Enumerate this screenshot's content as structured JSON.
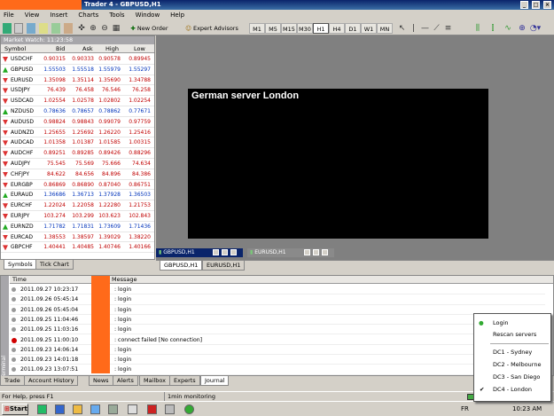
{
  "window": {
    "title": "Trader 4 - GBPUSD,H1"
  },
  "menu": [
    "File",
    "View",
    "Insert",
    "Charts",
    "Tools",
    "Window",
    "Help"
  ],
  "toolbar": {
    "new_order": "New Order",
    "expert_advisors": "Expert Advisors",
    "timeframes": [
      "M1",
      "M5",
      "M15",
      "M30",
      "H1",
      "H4",
      "D1",
      "W1",
      "MN"
    ],
    "selected_timeframe": "H1"
  },
  "market_watch": {
    "title": "Market Watch: 11:23:58",
    "headers": [
      "Symbol",
      "Bid",
      "Ask",
      "High",
      "Low"
    ],
    "rows": [
      {
        "symbol": "USDCHF",
        "bid": "0.90315",
        "ask": "0.90333",
        "high": "0.90578",
        "low": "0.89945",
        "dir": "down"
      },
      {
        "symbol": "GBPUSD",
        "bid": "1.55503",
        "ask": "1.55518",
        "high": "1.55979",
        "low": "1.55297",
        "dir": "up"
      },
      {
        "symbol": "EURUSD",
        "bid": "1.35098",
        "ask": "1.35114",
        "high": "1.35690",
        "low": "1.34788",
        "dir": "down"
      },
      {
        "symbol": "USDJPY",
        "bid": "76.439",
        "ask": "76.458",
        "high": "76.546",
        "low": "76.258",
        "dir": "down"
      },
      {
        "symbol": "USDCAD",
        "bid": "1.02554",
        "ask": "1.02578",
        "high": "1.02802",
        "low": "1.02254",
        "dir": "down"
      },
      {
        "symbol": "NZDUSD",
        "bid": "0.78636",
        "ask": "0.78657",
        "high": "0.78862",
        "low": "0.77671",
        "dir": "up"
      },
      {
        "symbol": "AUDUSD",
        "bid": "0.98824",
        "ask": "0.98843",
        "high": "0.99079",
        "low": "0.97759",
        "dir": "down"
      },
      {
        "symbol": "AUDNZD",
        "bid": "1.25655",
        "ask": "1.25692",
        "high": "1.26220",
        "low": "1.25416",
        "dir": "down"
      },
      {
        "symbol": "AUDCAD",
        "bid": "1.01358",
        "ask": "1.01387",
        "high": "1.01585",
        "low": "1.00315",
        "dir": "down"
      },
      {
        "symbol": "AUDCHF",
        "bid": "0.89251",
        "ask": "0.89285",
        "high": "0.89426",
        "low": "0.88296",
        "dir": "down"
      },
      {
        "symbol": "AUDJPY",
        "bid": "75.545",
        "ask": "75.569",
        "high": "75.666",
        "low": "74.634",
        "dir": "down"
      },
      {
        "symbol": "CHFJPY",
        "bid": "84.622",
        "ask": "84.656",
        "high": "84.896",
        "low": "84.386",
        "dir": "down"
      },
      {
        "symbol": "EURGBP",
        "bid": "0.86869",
        "ask": "0.86890",
        "high": "0.87040",
        "low": "0.86751",
        "dir": "down"
      },
      {
        "symbol": "EURAUD",
        "bid": "1.36686",
        "ask": "1.36713",
        "high": "1.37928",
        "low": "1.36503",
        "dir": "up"
      },
      {
        "symbol": "EURCHF",
        "bid": "1.22024",
        "ask": "1.22058",
        "high": "1.22280",
        "low": "1.21753",
        "dir": "down"
      },
      {
        "symbol": "EURJPY",
        "bid": "103.274",
        "ask": "103.299",
        "high": "103.623",
        "low": "102.843",
        "dir": "down"
      },
      {
        "symbol": "EURNZD",
        "bid": "1.71782",
        "ask": "1.71831",
        "high": "1.73609",
        "low": "1.71436",
        "dir": "up"
      },
      {
        "symbol": "EURCAD",
        "bid": "1.38553",
        "ask": "1.38597",
        "high": "1.39029",
        "low": "1.38220",
        "dir": "down"
      },
      {
        "symbol": "GBPCHF",
        "bid": "1.40441",
        "ask": "1.40485",
        "high": "1.40746",
        "low": "1.40166",
        "dir": "down"
      }
    ],
    "tabs": [
      "Symbols",
      "Tick Chart"
    ]
  },
  "chart": {
    "label": "German server London",
    "mini_windows": [
      "GBPUSD,H1",
      "EURUSD,H1"
    ],
    "tabs": [
      "GBPUSD,H1",
      "EURUSD,H1"
    ]
  },
  "terminal": {
    "headers": [
      "Time",
      "Message"
    ],
    "rows": [
      {
        "time": "2011.09.27 10:23:17",
        "msg": ": login",
        "err": false
      },
      {
        "time": "2011.09.26 05:45:14",
        "msg": ": login",
        "err": false
      },
      {
        "time": "2011.09.26 05:45:04",
        "msg": ": login",
        "err": false
      },
      {
        "time": "2011.09.25 11:04:46",
        "msg": ": login",
        "err": false
      },
      {
        "time": "2011.09.25 11:03:16",
        "msg": ": login",
        "err": false
      },
      {
        "time": "2011.09.25 11:00:10",
        "msg": ": connect failed [No connection]",
        "err": true
      },
      {
        "time": "2011.09.23 14:06:14",
        "msg": ": login",
        "err": false
      },
      {
        "time": "2011.09.23 14:01:18",
        "msg": ": login",
        "err": false
      },
      {
        "time": "2011.09.23 13:07:51",
        "msg": ": login",
        "err": false
      }
    ],
    "side_label": "Terminal",
    "tabs": [
      "Trade",
      "Account History",
      "News",
      "Alerts",
      "Mailbox",
      "Experts",
      "Journal"
    ],
    "active_tab": "Journal"
  },
  "status": {
    "help": "For Help, press F1",
    "monitoring": "1min monitoring"
  },
  "taskbar": {
    "start": "Start",
    "lang": "FR",
    "clock": "10:23 AM"
  },
  "popup": {
    "items": [
      "Login",
      "Rescan servers",
      "DC1 - Sydney",
      "DC2 - Melbourne",
      "DC3 - San Diego",
      "DC4 - London"
    ],
    "checked": "DC4 - London"
  }
}
